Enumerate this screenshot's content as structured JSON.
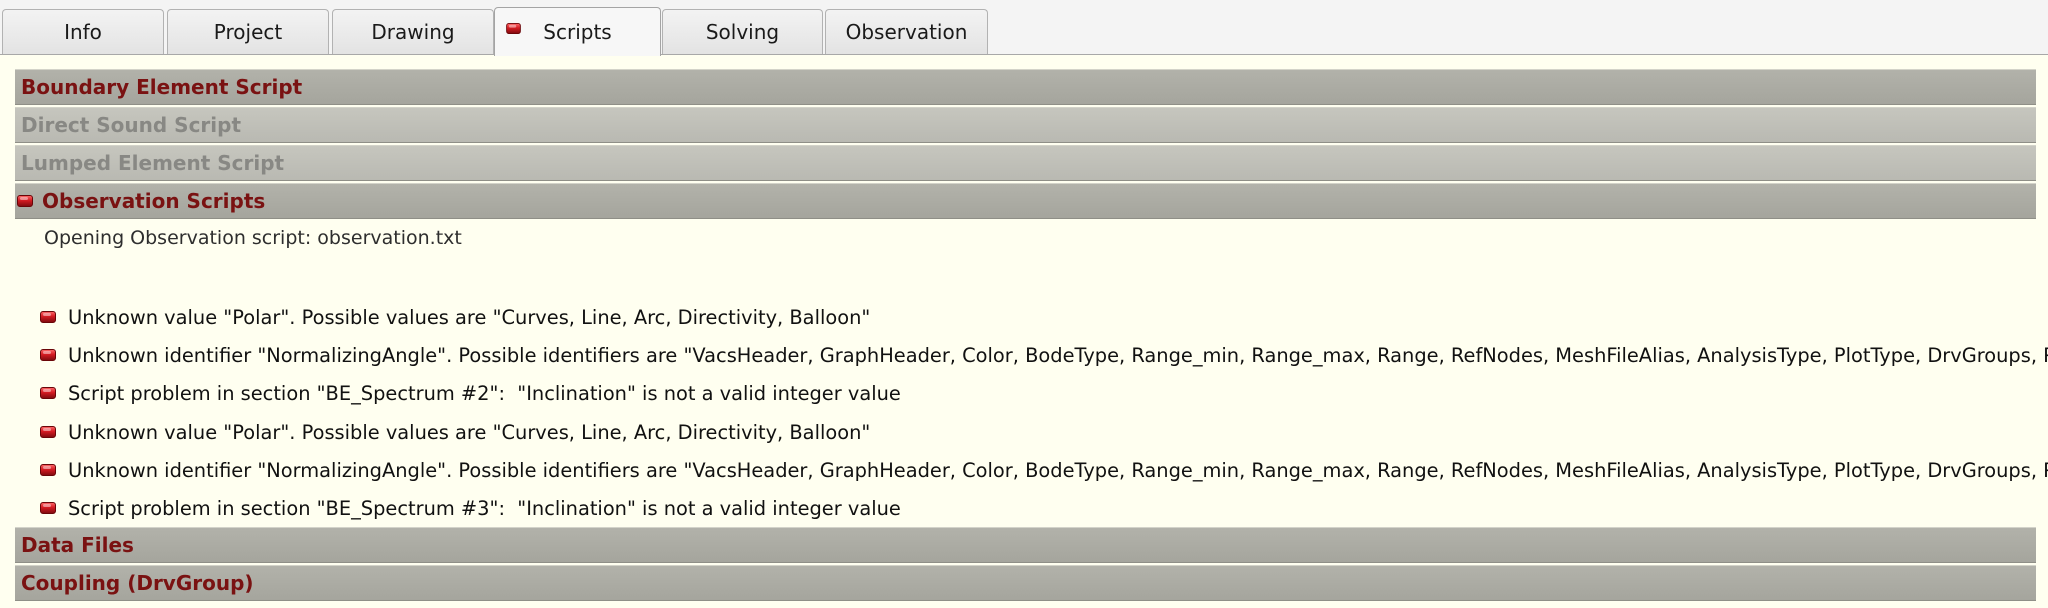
{
  "tabs": [
    {
      "label": "Info",
      "active": false,
      "has_error": false
    },
    {
      "label": "Project",
      "active": false,
      "has_error": false
    },
    {
      "label": "Drawing",
      "active": false,
      "has_error": false
    },
    {
      "label": "Scripts",
      "active": true,
      "has_error": true
    },
    {
      "label": "Solving",
      "active": false,
      "has_error": false
    },
    {
      "label": "Observation",
      "active": false,
      "has_error": false
    }
  ],
  "sections": {
    "boundary_element": {
      "label": "Boundary Element Script",
      "enabled": true
    },
    "direct_sound": {
      "label": "Direct Sound Script",
      "enabled": false
    },
    "lumped_element": {
      "label": "Lumped Element Script",
      "enabled": false
    },
    "observation": {
      "label": "Observation Scripts",
      "enabled": true,
      "has_error": true
    },
    "data_files": {
      "label": "Data Files",
      "enabled": true
    },
    "coupling": {
      "label": "Coupling (DrvGroup)",
      "enabled": true
    }
  },
  "observation_log": {
    "message": "Opening Observation script: observation.txt",
    "errors": [
      "Unknown value \"Polar\". Possible values are \"Curves, Line, Arc, Directivity, Balloon\"",
      "Unknown identifier \"NormalizingAngle\". Possible identifiers are \"VacsHeader, GraphHeader, Color, BodeType, Range_min, Range_max, Range, RefNodes, MeshFileAlias, AnalysisType, PlotType, DrvGroups, Po",
      "Script problem in section \"BE_Spectrum #2\":  \"Inclination\" is not a valid integer value",
      "Unknown value \"Polar\". Possible values are \"Curves, Line, Arc, Directivity, Balloon\"",
      "Unknown identifier \"NormalizingAngle\". Possible identifiers are \"VacsHeader, GraphHeader, Color, BodeType, Range_min, Range_max, Range, RefNodes, MeshFileAlias, AnalysisType, PlotType, DrvGroups, Po",
      "Script problem in section \"BE_Spectrum #3\":  \"Inclination\" is not a valid integer value"
    ]
  },
  "colors": {
    "error_led": "#c8161e",
    "section_title": "#7a1212",
    "panel_background": "#fffff0"
  },
  "icons": {
    "error_indicator": "error-led-icon"
  }
}
